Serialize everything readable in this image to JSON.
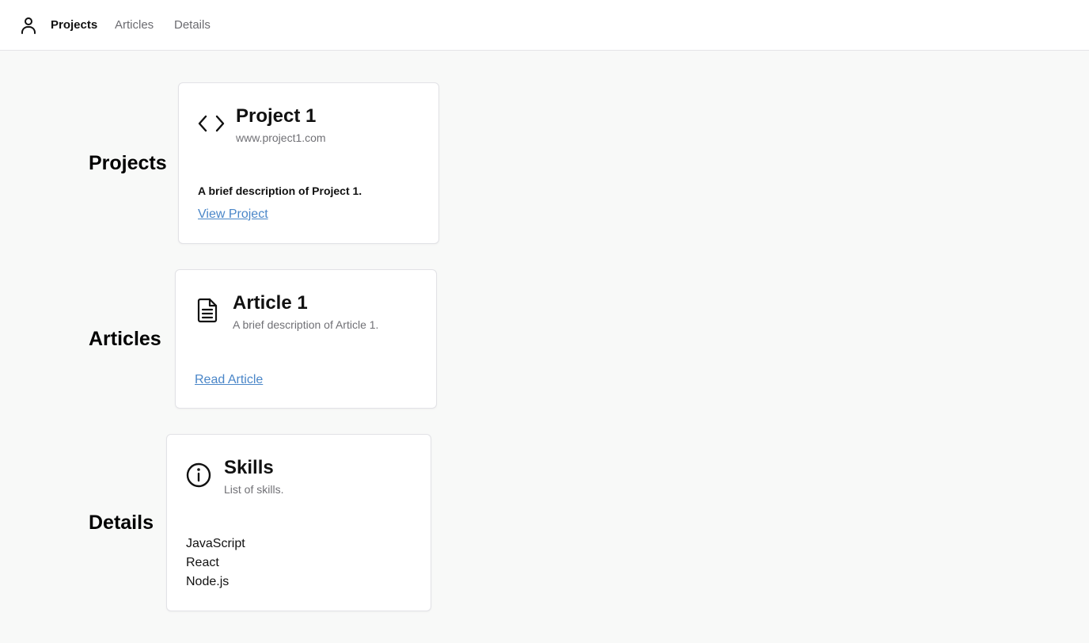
{
  "nav": {
    "user_icon": "user-icon",
    "items": [
      {
        "label": "Projects",
        "active": true
      },
      {
        "label": "Articles",
        "active": false
      },
      {
        "label": "Details",
        "active": false
      }
    ]
  },
  "sections": {
    "projects": {
      "heading": "Projects",
      "card": {
        "icon": "code-icon",
        "title": "Project 1",
        "subtitle": "www.project1.com",
        "description": "A brief description of Project 1.",
        "link_label": "View Project"
      }
    },
    "articles": {
      "heading": "Articles",
      "card": {
        "icon": "document-icon",
        "title": "Article 1",
        "subtitle": "A brief description of Article 1.",
        "link_label": "Read Article"
      }
    },
    "details": {
      "heading": "Details",
      "card": {
        "icon": "info-icon",
        "title": "Skills",
        "subtitle": "List of skills.",
        "skills": [
          "JavaScript",
          "React",
          "Node.js"
        ]
      }
    }
  },
  "colors": {
    "background": "#f8f9f8",
    "card": "#ffffff",
    "link": "#4a86c8",
    "muted_text": "#707075"
  }
}
